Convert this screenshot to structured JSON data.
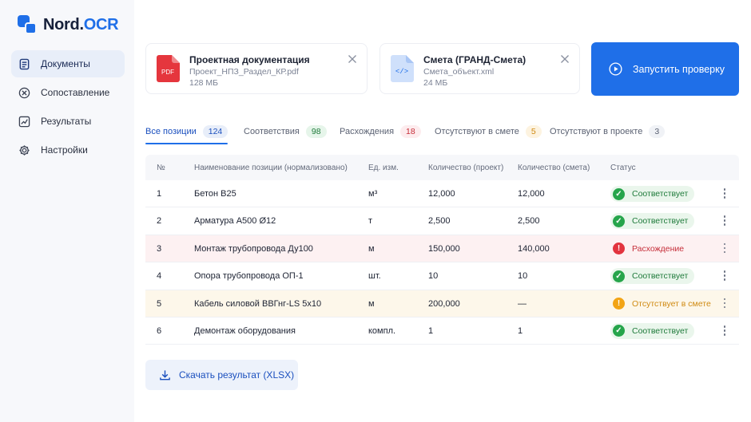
{
  "app": {
    "logo_part1": "Nord.",
    "logo_part2": "OCR",
    "brand_color": "#1f6fe8"
  },
  "sidebar": {
    "items": [
      {
        "label": "Документы",
        "icon": "document-icon",
        "active": true
      },
      {
        "label": "Сопоставление",
        "icon": "compare-icon",
        "active": false
      },
      {
        "label": "Результаты",
        "icon": "chart-icon",
        "active": false
      },
      {
        "label": "Настройки",
        "icon": "gear-icon",
        "active": false
      }
    ]
  },
  "files": [
    {
      "title": "Проектная документация",
      "filename": "Проект_НПЗ_Раздел_КР.pdf",
      "size": "128 МБ",
      "icon": "pdf-file-icon",
      "icon_text": "PDF"
    },
    {
      "title": "Смета (ГРАНД-Смета)",
      "filename": "Смета_объект.xml",
      "size": "24 МБ",
      "icon": "xml-file-icon",
      "icon_text": "</>"
    }
  ],
  "run_button": {
    "label": "Запустить проверку"
  },
  "tabs": [
    {
      "label": "Все позиции",
      "count": "124",
      "active": true,
      "badge_bg": "#e8eef9",
      "badge_color": "#1a4fbe"
    },
    {
      "label": "Соответствия",
      "count": "98",
      "active": false,
      "badge_bg": "#e6f5ea",
      "badge_color": "#1e7a3a"
    },
    {
      "label": "Расхождения",
      "count": "18",
      "active": false,
      "badge_bg": "#fdecee",
      "badge_color": "#c62f3a"
    },
    {
      "label": "Отсутствуют в смете",
      "count": "5",
      "active": false,
      "badge_bg": "#fdf3e0",
      "badge_color": "#d08a12"
    },
    {
      "label": "Отсутствуют в проекте",
      "count": "3",
      "active": false,
      "badge_bg": "#f0f2f6",
      "badge_color": "#5a6172"
    }
  ],
  "table": {
    "headers": [
      "№",
      "Наименование позиции (нормализовано)",
      "Ед. изм.",
      "Количество (проект)",
      "Количество (смета)",
      "Статус"
    ],
    "rows": [
      {
        "n": "1",
        "name": "Бетон В25",
        "unit": "м³",
        "qty_project": "12,000",
        "qty_estimate": "12,000",
        "status": "Соответствует",
        "kind": "ok"
      },
      {
        "n": "2",
        "name": "Арматура А500 Ø12",
        "unit": "т",
        "qty_project": "2,500",
        "qty_estimate": "2,500",
        "status": "Соответствует",
        "kind": "ok"
      },
      {
        "n": "3",
        "name": "Монтаж трубопровода Ду100",
        "unit": "м",
        "qty_project": "150,000",
        "qty_estimate": "140,000",
        "status": "Расхождение",
        "kind": "diff"
      },
      {
        "n": "4",
        "name": "Опора трубопровода ОП-1",
        "unit": "шт.",
        "qty_project": "10",
        "qty_estimate": "10",
        "status": "Соответствует",
        "kind": "ok"
      },
      {
        "n": "5",
        "name": "Кабель силовой ВВГнг-LS 5x10",
        "unit": "м",
        "qty_project": "200,000",
        "qty_estimate": "—",
        "status": "Отсутствует в смете",
        "kind": "missing"
      },
      {
        "n": "6",
        "name": "Демонтаж оборудования",
        "unit": "компл.",
        "qty_project": "1",
        "qty_estimate": "1",
        "status": "Соответствует",
        "kind": "ok"
      }
    ]
  },
  "download_button": {
    "label": "Скачать результат (XLSX)"
  }
}
